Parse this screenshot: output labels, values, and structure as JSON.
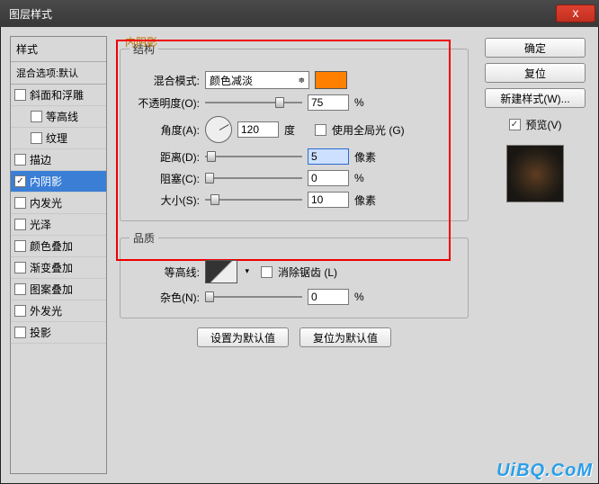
{
  "window": {
    "title": "图层样式",
    "close": "x"
  },
  "left": {
    "header": "样式",
    "sub": "混合选项:默认",
    "items": [
      {
        "label": "斜面和浮雕",
        "checked": false,
        "selected": false,
        "sub": false
      },
      {
        "label": "等高线",
        "checked": false,
        "selected": false,
        "sub": true
      },
      {
        "label": "纹理",
        "checked": false,
        "selected": false,
        "sub": true
      },
      {
        "label": "描边",
        "checked": false,
        "selected": false,
        "sub": false
      },
      {
        "label": "内阴影",
        "checked": true,
        "selected": true,
        "sub": false
      },
      {
        "label": "内发光",
        "checked": false,
        "selected": false,
        "sub": false
      },
      {
        "label": "光泽",
        "checked": false,
        "selected": false,
        "sub": false
      },
      {
        "label": "颜色叠加",
        "checked": false,
        "selected": false,
        "sub": false
      },
      {
        "label": "渐变叠加",
        "checked": false,
        "selected": false,
        "sub": false
      },
      {
        "label": "图案叠加",
        "checked": false,
        "selected": false,
        "sub": false
      },
      {
        "label": "外发光",
        "checked": false,
        "selected": false,
        "sub": false
      },
      {
        "label": "投影",
        "checked": false,
        "selected": false,
        "sub": false
      }
    ]
  },
  "mid": {
    "title": "内阴影",
    "s1": {
      "legend": "结构",
      "blend_label": "混合模式:",
      "blend_value": "颜色减淡",
      "opacity_label": "不透明度(O):",
      "opacity_value": "75",
      "opacity_unit": "%",
      "angle_label": "角度(A):",
      "angle_value": "120",
      "angle_unit": "度",
      "global_label": "使用全局光 (G)",
      "distance_label": "距离(D):",
      "distance_value": "5",
      "distance_unit": "像素",
      "choke_label": "阻塞(C):",
      "choke_value": "0",
      "choke_unit": "%",
      "size_label": "大小(S):",
      "size_value": "10",
      "size_unit": "像素"
    },
    "s2": {
      "legend": "品质",
      "contour_label": "等高线:",
      "aa_label": "消除锯齿 (L)",
      "noise_label": "杂色(N):",
      "noise_value": "0",
      "noise_unit": "%"
    },
    "buttons": {
      "default": "设置为默认值",
      "reset": "复位为默认值"
    }
  },
  "right": {
    "ok": "确定",
    "cancel": "复位",
    "newstyle": "新建样式(W)...",
    "preview_label": "预览(V)"
  },
  "watermark": "UiBQ.CoM",
  "colors": {
    "swatch": "#ff7f00",
    "highlight": "#e00000",
    "selected": "#3a7ed6"
  }
}
